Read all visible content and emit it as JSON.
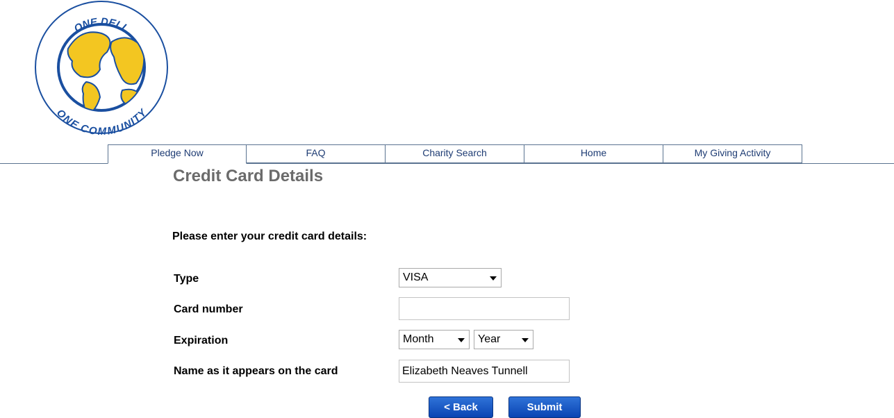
{
  "logo": {
    "top_text": "ONE DELL",
    "bottom_text": "ONE COMMUNITY"
  },
  "nav": {
    "tabs": [
      {
        "label": "Pledge Now",
        "active": true
      },
      {
        "label": "FAQ"
      },
      {
        "label": "Charity Search"
      },
      {
        "label": "Home"
      },
      {
        "label": "My Giving Activity"
      }
    ]
  },
  "page": {
    "title": "Credit Card Details",
    "intro": "Please enter your credit card details:"
  },
  "form": {
    "type_label": "Type",
    "type_value": "VISA",
    "card_number_label": "Card number",
    "card_number_value": "",
    "expiration_label": "Expiration",
    "month_value": "Month",
    "year_value": "Year",
    "name_label": "Name as it appears on the card",
    "name_value": "Elizabeth Neaves Tunnell"
  },
  "buttons": {
    "back": "< Back",
    "submit": "Submit"
  },
  "colors": {
    "nav_text": "#1d3b73",
    "button": "#0a44b3",
    "logo_yellow": "#f3c621",
    "logo_blue": "#1a4fa0"
  }
}
